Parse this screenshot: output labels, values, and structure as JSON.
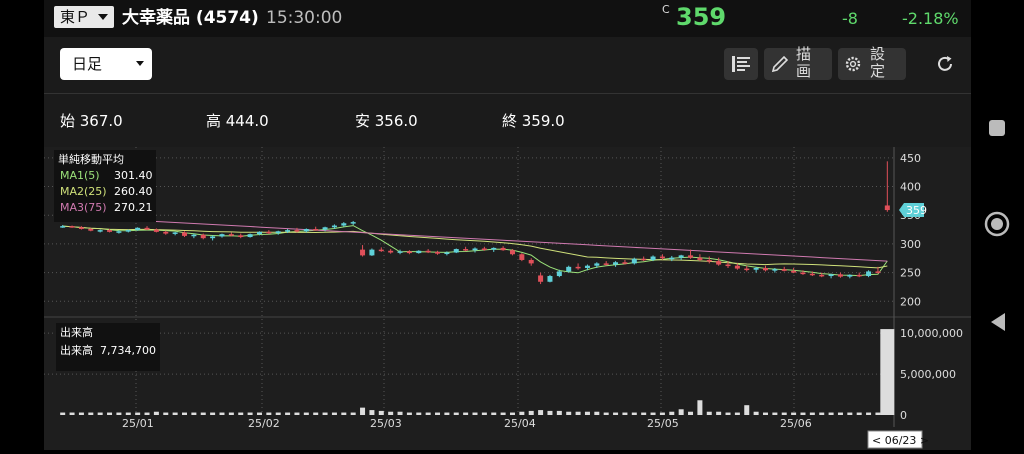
{
  "header": {
    "market": "東Ｐ",
    "stock_name": "大幸薬品 (4574)",
    "time": "15:30:00",
    "price_mark": "C",
    "price": "359",
    "change": "-8",
    "change_pct": "-2.18%"
  },
  "toolbar": {
    "period": "日足",
    "draw_label": "描画",
    "settings_label": "設定"
  },
  "ohlc": {
    "open": "始 367.0",
    "high": "高 444.0",
    "low": "安 356.0",
    "close": "終 359.0"
  },
  "legend": {
    "title": "単純移動平均",
    "ma1": "MA1(5)",
    "ma1_value": "301.40",
    "ma2": "MA2(25)",
    "ma2_value": "260.40",
    "ma3": "MA3(75)",
    "ma3_value": "270.21"
  },
  "volume_legend": {
    "title": "出来高",
    "label": "出来高",
    "value": "7,734,700"
  },
  "price_axis": [
    "450",
    "400",
    "350",
    "300",
    "250",
    "200"
  ],
  "volume_axis": [
    "10,000,000",
    "5,000,000",
    "0"
  ],
  "x_axis": [
    "25/01",
    "25/02",
    "25/03",
    "25/04",
    "25/05",
    "25/06"
  ],
  "current_price_tag": "359",
  "date_tag": "< 06/23 >",
  "colors": {
    "up": "#5fd0d8",
    "down": "#e0505a",
    "price_green": "#5fd96c",
    "ma1": "#9be27a",
    "ma2": "#cfe07a",
    "ma3": "#d07ab0"
  },
  "chart_data": {
    "type": "candlestick",
    "title": "",
    "ylim": [
      190,
      455
    ],
    "volume_ylim": [
      0,
      11000000
    ],
    "candles": [
      [
        330,
        333,
        328,
        331
      ],
      [
        331,
        332,
        328,
        329
      ],
      [
        329,
        331,
        325,
        326
      ],
      [
        326,
        328,
        322,
        323
      ],
      [
        323,
        325,
        320,
        324
      ],
      [
        324,
        326,
        320,
        321
      ],
      [
        321,
        324,
        318,
        322
      ],
      [
        322,
        325,
        320,
        324
      ],
      [
        324,
        329,
        323,
        328
      ],
      [
        328,
        331,
        324,
        325
      ],
      [
        325,
        327,
        320,
        321
      ],
      [
        321,
        323,
        316,
        318
      ],
      [
        318,
        321,
        315,
        320
      ],
      [
        320,
        322,
        312,
        314
      ],
      [
        314,
        318,
        310,
        316
      ],
      [
        316,
        318,
        308,
        310
      ],
      [
        310,
        315,
        306,
        313
      ],
      [
        313,
        318,
        311,
        317
      ],
      [
        317,
        320,
        313,
        315
      ],
      [
        315,
        318,
        310,
        312
      ],
      [
        312,
        318,
        311,
        317
      ],
      [
        317,
        322,
        315,
        321
      ],
      [
        321,
        324,
        317,
        319
      ],
      [
        319,
        323,
        316,
        322
      ],
      [
        322,
        326,
        319,
        324
      ],
      [
        324,
        328,
        320,
        322
      ],
      [
        322,
        327,
        320,
        326
      ],
      [
        326,
        330,
        323,
        325
      ],
      [
        325,
        330,
        322,
        329
      ],
      [
        329,
        334,
        326,
        332
      ],
      [
        332,
        338,
        330,
        336
      ],
      [
        336,
        340,
        333,
        338
      ],
      [
        290,
        298,
        278,
        280
      ],
      [
        280,
        292,
        279,
        290
      ],
      [
        290,
        294,
        286,
        288
      ],
      [
        288,
        291,
        283,
        285
      ],
      [
        285,
        290,
        282,
        287
      ],
      [
        287,
        289,
        282,
        284
      ],
      [
        284,
        289,
        283,
        288
      ],
      [
        288,
        291,
        284,
        286
      ],
      [
        286,
        288,
        281,
        283
      ],
      [
        283,
        287,
        280,
        285
      ],
      [
        285,
        292,
        284,
        291
      ],
      [
        291,
        295,
        287,
        289
      ],
      [
        289,
        294,
        285,
        292
      ],
      [
        292,
        295,
        288,
        290
      ],
      [
        290,
        294,
        286,
        293
      ],
      [
        293,
        296,
        288,
        289
      ],
      [
        289,
        291,
        280,
        282
      ],
      [
        282,
        284,
        270,
        272
      ],
      [
        272,
        275,
        262,
        266
      ],
      [
        245,
        250,
        230,
        234
      ],
      [
        234,
        246,
        233,
        244
      ],
      [
        244,
        255,
        242,
        252
      ],
      [
        252,
        262,
        250,
        260
      ],
      [
        260,
        266,
        255,
        258
      ],
      [
        258,
        264,
        254,
        262
      ],
      [
        262,
        268,
        258,
        266
      ],
      [
        266,
        270,
        262,
        264
      ],
      [
        264,
        270,
        260,
        268
      ],
      [
        268,
        272,
        264,
        266
      ],
      [
        266,
        276,
        264,
        274
      ],
      [
        274,
        278,
        270,
        272
      ],
      [
        272,
        280,
        270,
        278
      ],
      [
        278,
        282,
        272,
        275
      ],
      [
        275,
        279,
        270,
        276
      ],
      [
        276,
        281,
        272,
        280
      ],
      [
        280,
        290,
        274,
        276
      ],
      [
        276,
        282,
        270,
        272
      ],
      [
        272,
        278,
        266,
        270
      ],
      [
        270,
        276,
        262,
        264
      ],
      [
        264,
        270,
        258,
        262
      ],
      [
        262,
        266,
        255,
        257
      ],
      [
        257,
        262,
        252,
        255
      ],
      [
        255,
        260,
        250,
        258
      ],
      [
        258,
        262,
        252,
        254
      ],
      [
        254,
        258,
        250,
        256
      ],
      [
        256,
        260,
        252,
        253
      ],
      [
        253,
        258,
        249,
        250
      ],
      [
        250,
        254,
        246,
        248
      ],
      [
        248,
        252,
        244,
        246
      ],
      [
        246,
        250,
        242,
        244
      ],
      [
        244,
        248,
        240,
        247
      ],
      [
        247,
        250,
        241,
        243
      ],
      [
        243,
        247,
        240,
        246
      ],
      [
        246,
        250,
        242,
        244
      ],
      [
        244,
        254,
        242,
        252
      ],
      [
        252,
        260,
        248,
        250
      ],
      [
        367,
        444,
        356,
        359
      ]
    ],
    "volumes": [
      0.3,
      0.3,
      0.3,
      0.3,
      0.3,
      0.3,
      0.3,
      0.3,
      0.3,
      0.3,
      0.4,
      0.3,
      0.3,
      0.3,
      0.3,
      0.3,
      0.3,
      0.3,
      0.3,
      0.3,
      0.3,
      0.3,
      0.3,
      0.3,
      0.3,
      0.3,
      0.3,
      0.3,
      0.3,
      0.3,
      0.3,
      0.3,
      0.9,
      0.6,
      0.5,
      0.4,
      0.4,
      0.3,
      0.3,
      0.3,
      0.3,
      0.3,
      0.3,
      0.3,
      0.3,
      0.3,
      0.3,
      0.3,
      0.3,
      0.4,
      0.5,
      0.6,
      0.5,
      0.5,
      0.4,
      0.4,
      0.4,
      0.4,
      0.3,
      0.3,
      0.3,
      0.3,
      0.3,
      0.3,
      0.3,
      0.4,
      0.7,
      0.4,
      1.8,
      0.4,
      0.4,
      0.3,
      0.3,
      1.2,
      0.4,
      0.3,
      0.3,
      0.3,
      0.3,
      0.3,
      0.3,
      0.3,
      0.3,
      0.3,
      0.3,
      0.3,
      0.3,
      0.3,
      10.5
    ],
    "ma1_value": 301.4,
    "ma2_value": 260.4,
    "ma3_value": 270.21,
    "x_tick_labels": [
      "25/01",
      "25/02",
      "25/03",
      "25/04",
      "25/05",
      "25/06"
    ],
    "y_tick_labels": [
      "450",
      "400",
      "350",
      "300",
      "250",
      "200"
    ]
  }
}
